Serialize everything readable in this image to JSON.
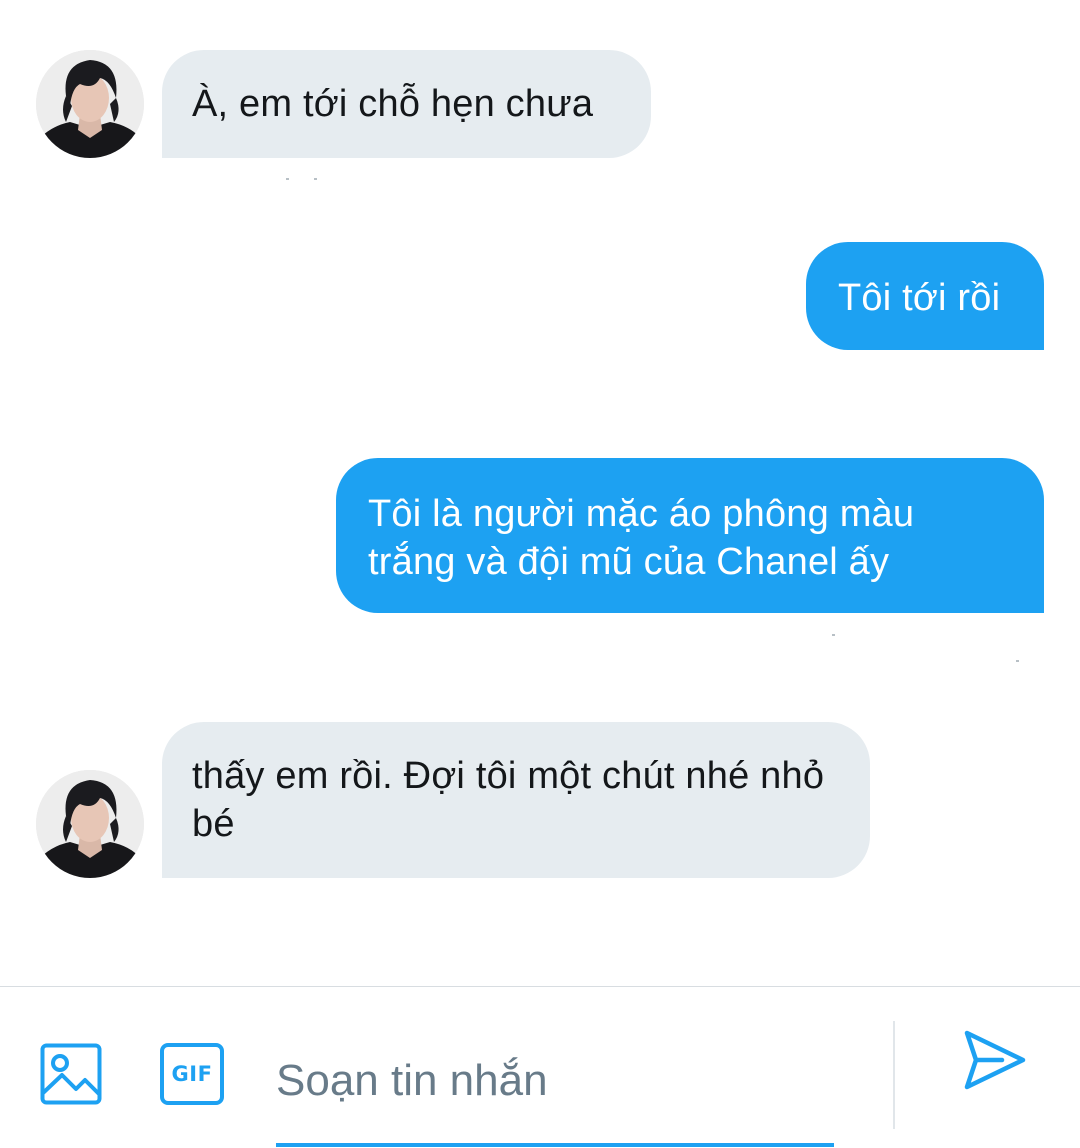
{
  "conversation": {
    "messages": [
      {
        "direction": "incoming",
        "text": "À, em tới chỗ hẹn chưa"
      },
      {
        "direction": "outgoing",
        "text": "Tôi tới rồi"
      },
      {
        "direction": "outgoing",
        "text": "Tôi là người mặc áo phông màu trắng và đội mũ của Chanel ấy"
      },
      {
        "direction": "incoming",
        "text": "thấy em rồi. Đợi tôi một chút nhé nhỏ bé"
      }
    ]
  },
  "composer": {
    "media_icon": "image-icon",
    "gif_label": "GIF",
    "placeholder": "Soạn tin nhắn",
    "send_icon": "send-icon"
  },
  "colors": {
    "accent": "#1da1f2",
    "incoming_bubble": "#e6ecf0",
    "incoming_text": "#14171a",
    "placeholder": "#687b89"
  }
}
